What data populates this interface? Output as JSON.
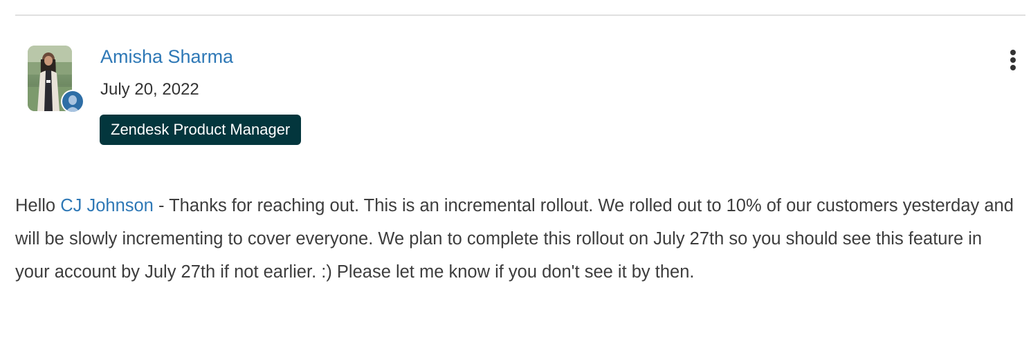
{
  "comment": {
    "author": {
      "name": "Amisha Sharma",
      "date": "July 20, 2022",
      "role_badge": "Zendesk Product Manager",
      "avatar_icon": "user-photo",
      "status_icon": "user-icon"
    },
    "menu_icon": "vertical-ellipsis-icon",
    "body": {
      "greeting": "Hello ",
      "mention": "CJ Johnson",
      "text": " - Thanks for reaching out. This is an incremental rollout. We rolled out to 10% of our customers yesterday and will be slowly incrementing to cover everyone. We plan to complete this rollout on July 27th so you should see this feature in your account by July 27th if not earlier. :) Please let me know if you don't see it by then."
    }
  },
  "colors": {
    "link": "#2e78b6",
    "badge_bg": "#03363d",
    "text": "#333333",
    "divider": "#e0e0e0"
  }
}
